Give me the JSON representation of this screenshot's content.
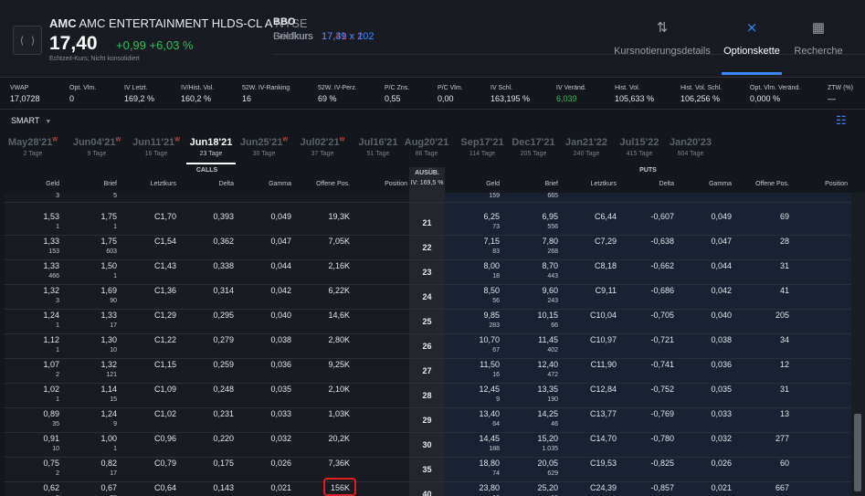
{
  "quote": {
    "ticker": "AMC",
    "name": "AMC ENTERTAINMENT HLDS-CL A",
    "exchange": "NYSE",
    "price": "17,40",
    "change": "+0,99",
    "change_pct": "+6,03 %",
    "realtime_note": "Echtzeit-Kurs; Nicht konsolidiert"
  },
  "bbo": {
    "title": "BBO",
    "ask_label": "Briefkurs",
    "ask": "17,41 x 2",
    "bid_label": "Geldkurs",
    "bid": "17,39 x 102"
  },
  "tabs": [
    {
      "label": "Kursnotierungsdetails",
      "icon": "sort-arrows-icon"
    },
    {
      "label": "Optionskette",
      "icon": "option-chain-icon",
      "active": true
    },
    {
      "label": "Recherche",
      "icon": "building-icon"
    }
  ],
  "stats": [
    {
      "l": "VWAP",
      "v": "17,0728"
    },
    {
      "l": "Opt. Vlm.",
      "v": "0"
    },
    {
      "l": "IV Letzt.",
      "v": "169,2 %"
    },
    {
      "l": "IV/Hist. Vol.",
      "v": "160,2 %"
    },
    {
      "l": "52W. IV-Ranking",
      "v": "16"
    },
    {
      "l": "52W. IV-Perz.",
      "v": "69 %"
    },
    {
      "l": "P/C Zns.",
      "v": "0,55"
    },
    {
      "l": "P/C Vlm.",
      "v": "0,00"
    },
    {
      "l": "IV Schl.",
      "v": "163,195 %"
    },
    {
      "l": "IV Veränd.",
      "v": "6,039"
    },
    {
      "l": "Hist. Vol.",
      "v": "105,633 %"
    },
    {
      "l": "Hist. Vol. Schl.",
      "v": "106,256 %"
    },
    {
      "l": "Opt. Vlm. Veränd.",
      "v": "0,000 %"
    },
    {
      "l": "ZTW (%)",
      "v": "—"
    }
  ],
  "route": "SMART",
  "expirations": [
    {
      "d": "May28'21",
      "n": "2 Tage",
      "flag": "W"
    },
    {
      "d": "Jun04'21",
      "n": "9 Tage",
      "flag": "W"
    },
    {
      "d": "Jun11'21",
      "n": "16 Tage",
      "flag": "W"
    },
    {
      "d": "Jun18'21",
      "n": "23 Tage",
      "selected": true
    },
    {
      "d": "Jun25'21",
      "n": "30 Tage",
      "flag": "W"
    },
    {
      "d": "Jul02'21",
      "n": "37 Tage",
      "flag": "W"
    },
    {
      "d": "Jul16'21",
      "n": "51 Tage"
    },
    {
      "d": "Aug20'21",
      "n": "86 Tage"
    },
    {
      "d": "Sep17'21",
      "n": "114 Tage"
    },
    {
      "d": "Dec17'21",
      "n": "205 Tage"
    },
    {
      "d": "Jan21'22",
      "n": "240 Tage"
    },
    {
      "d": "Jul15'22",
      "n": "415 Tage"
    },
    {
      "d": "Jan20'23",
      "n": "604 Tage"
    }
  ],
  "headers": {
    "calls": "CALLS",
    "puts": "PUTS",
    "strike": "AUSÜB.",
    "iv": "IV: 169,5 %",
    "call_cols": [
      "Geld",
      "Brief",
      "Letztkurs",
      "Delta",
      "Gamma",
      "Offene Pos.",
      "Position"
    ],
    "put_cols": [
      "Geld",
      "Brief",
      "Letztkurs",
      "Delta",
      "Gamma",
      "Offene Pos.",
      "Position"
    ]
  },
  "partial_row": {
    "bid_size": "3",
    "ask_size": "5",
    "put_bid_size": "159",
    "put_ask_size": "665"
  },
  "rows": [
    {
      "s": "21",
      "cb": "1,53",
      "cbs": "1",
      "ca": "1,75",
      "cas": "1",
      "cl": "C1,70",
      "cd": "0,393",
      "cg": "0,049",
      "co": "19,3K",
      "pb": "6,25",
      "pbs": "73",
      "pa": "6,95",
      "pas": "556",
      "pl": "C6,44",
      "pd": "-0,607",
      "pg": "0,049",
      "po": "69"
    },
    {
      "s": "22",
      "cb": "1,33",
      "cbs": "153",
      "ca": "1,75",
      "cas": "603",
      "cl": "C1,54",
      "cd": "0,362",
      "cg": "0,047",
      "co": "7,05K",
      "pb": "7,15",
      "pbs": "83",
      "pa": "7,80",
      "pas": "268",
      "pl": "C7,29",
      "pd": "-0,638",
      "pg": "0,047",
      "po": "28"
    },
    {
      "s": "23",
      "cb": "1,33",
      "cbs": "466",
      "ca": "1,50",
      "cas": "1",
      "cl": "C1,43",
      "cd": "0,338",
      "cg": "0,044",
      "co": "2,16K",
      "pb": "8,00",
      "pbs": "18",
      "pa": "8,70",
      "pas": "443",
      "pl": "C8,18",
      "pd": "-0,662",
      "pg": "0,044",
      "po": "31"
    },
    {
      "s": "24",
      "cb": "1,32",
      "cbs": "3",
      "ca": "1,69",
      "cas": "90",
      "cl": "C1,36",
      "cd": "0,314",
      "cg": "0,042",
      "co": "6,22K",
      "pb": "8,50",
      "pbs": "56",
      "pa": "9,60",
      "pas": "243",
      "pl": "C9,11",
      "pd": "-0,686",
      "pg": "0,042",
      "po": "41"
    },
    {
      "s": "25",
      "cb": "1,24",
      "cbs": "1",
      "ca": "1,33",
      "cas": "17",
      "cl": "C1,29",
      "cd": "0,295",
      "cg": "0,040",
      "co": "14,6K",
      "pb": "9,85",
      "pbs": "283",
      "pa": "10,15",
      "pas": "66",
      "pl": "C10,04",
      "pd": "-0,705",
      "pg": "0,040",
      "po": "205"
    },
    {
      "s": "26",
      "cb": "1,12",
      "cbs": "1",
      "ca": "1,30",
      "cas": "10",
      "cl": "C1,22",
      "cd": "0,279",
      "cg": "0,038",
      "co": "2,80K",
      "pb": "10,70",
      "pbs": "67",
      "pa": "11,45",
      "pas": "402",
      "pl": "C10,97",
      "pd": "-0,721",
      "pg": "0,038",
      "po": "34"
    },
    {
      "s": "27",
      "cb": "1,07",
      "cbs": "2",
      "ca": "1,32",
      "cas": "121",
      "cl": "C1,15",
      "cd": "0,259",
      "cg": "0,036",
      "co": "9,25K",
      "pb": "11,50",
      "pbs": "16",
      "pa": "12,40",
      "pas": "472",
      "pl": "C11,90",
      "pd": "-0,741",
      "pg": "0,036",
      "po": "12"
    },
    {
      "s": "28",
      "cb": "1,02",
      "cbs": "1",
      "ca": "1,14",
      "cas": "15",
      "cl": "C1,09",
      "cd": "0,248",
      "cg": "0,035",
      "co": "2,10K",
      "pb": "12,45",
      "pbs": "9",
      "pa": "13,35",
      "pas": "190",
      "pl": "C12,84",
      "pd": "-0,752",
      "pg": "0,035",
      "po": "31"
    },
    {
      "s": "29",
      "cb": "0,89",
      "cbs": "35",
      "ca": "1,24",
      "cas": "9",
      "cl": "C1,02",
      "cd": "0,231",
      "cg": "0,033",
      "co": "1,03K",
      "pb": "13,40",
      "pbs": "64",
      "pa": "14,25",
      "pas": "46",
      "pl": "C13,77",
      "pd": "-0,769",
      "pg": "0,033",
      "po": "13"
    },
    {
      "s": "30",
      "cb": "0,91",
      "cbs": "10",
      "ca": "1,00",
      "cas": "1",
      "cl": "C0,96",
      "cd": "0,220",
      "cg": "0,032",
      "co": "20,2K",
      "pb": "14,45",
      "pbs": "188",
      "pa": "15,20",
      "pas": "1.035",
      "pl": "C14,70",
      "pd": "-0,780",
      "pg": "0,032",
      "po": "277"
    },
    {
      "s": "35",
      "cb": "0,75",
      "cbs": "2",
      "ca": "0,82",
      "cas": "17",
      "cl": "C0,79",
      "cd": "0,175",
      "cg": "0,026",
      "co": "7,36K",
      "pb": "18,80",
      "pbs": "74",
      "pa": "20,05",
      "pas": "629",
      "pl": "C19,53",
      "pd": "-0,825",
      "pg": "0,026",
      "po": "60"
    },
    {
      "s": "40",
      "cb": "0,62",
      "cbs": "2",
      "ca": "0,67",
      "cas": "25",
      "cl": "C0,64",
      "cd": "0,143",
      "cg": "0,021",
      "co": "156K",
      "pb": "23,80",
      "pbs": "10",
      "pa": "25,20",
      "pas": "15",
      "pl": "C24,39",
      "pd": "-0,857",
      "pg": "0,021",
      "po": "667",
      "highlight": true
    }
  ]
}
